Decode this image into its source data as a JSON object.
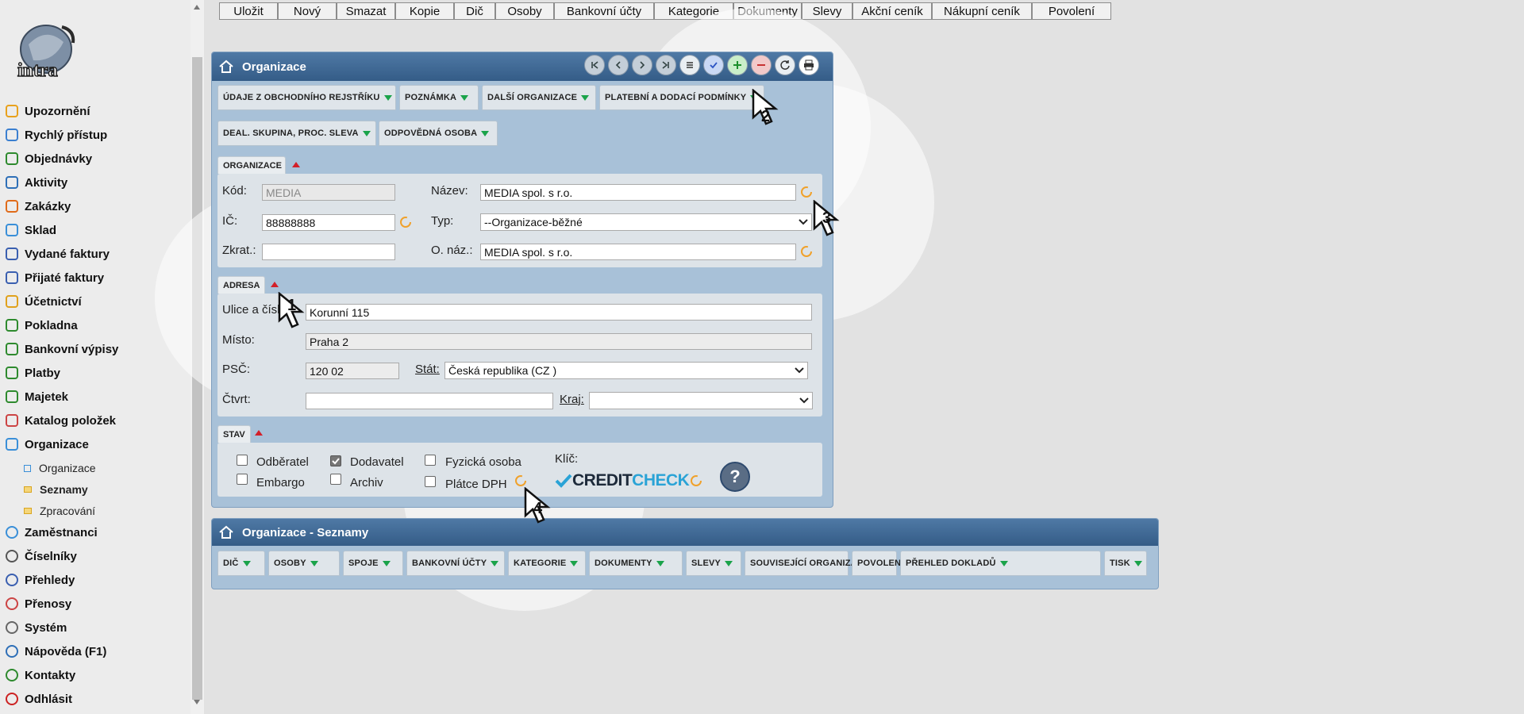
{
  "toolbar": [
    "Uložit",
    "Nový",
    "Smazat",
    "Kopie",
    "Dič",
    "Osoby",
    "Bankovní účty",
    "Kategorie",
    "Dokumenty",
    "Slevy",
    "Akční ceník",
    "Nákupní ceník",
    "Povolení"
  ],
  "sidebar": {
    "logo_text": "intra",
    "items": [
      "Upozornění",
      "Rychlý přístup",
      "Objednávky",
      "Aktivity",
      "Zakázky",
      "Sklad",
      "Vydané faktury",
      "Přijaté faktury",
      "Účetnictví",
      "Pokladna",
      "Bankovní výpisy",
      "Platby",
      "Majetek",
      "Katalog položek",
      "Organizace"
    ],
    "subitems": [
      "Organizace",
      "Seznamy",
      "Zpracování"
    ],
    "items_after": [
      "Zaměstnanci",
      "Číselníky",
      "Přehledy",
      "Přenosy",
      "Systém",
      "Nápověda (F1)",
      "Kontakty",
      "Odhlásit"
    ]
  },
  "org_panel": {
    "title": "Organizace",
    "tabs_row1": [
      "ÚDAJE Z OBCHODNÍHO REJSTŘÍKU",
      "POZNÁMKA",
      "DALŠÍ ORGANIZACE",
      "PLATEBNÍ A DODACÍ PODMÍNKY"
    ],
    "tabs_row2": [
      "DEAL. SKUPINA, PROC. SLEVA",
      "ODPOVĚDNÁ OSOBA"
    ],
    "sec_org": "ORGANIZACE",
    "kod_label": "Kód:",
    "kod_value": "MEDIA",
    "nazev_label": "Název:",
    "nazev_value": "MEDIA spol. s r.o.",
    "ic_label": "IČ:",
    "ic_value": "88888888",
    "typ_label": "Typ:",
    "typ_value": "--Organizace-běžné",
    "zkrat_label": "Zkrat.:",
    "zkrat_value": "",
    "onaz_label": "O. náz.:",
    "onaz_value": "MEDIA spol. s r.o.",
    "sec_adresa": "ADRESA",
    "ulice_label": "Ulice a číslo:",
    "ulice_value": "Korunní 115",
    "misto_label": "Místo:",
    "misto_value": "Praha 2",
    "psc_label": "PSČ:",
    "psc_value": "120 02",
    "stat_label": "Stát:",
    "stat_value": "Česká republika (CZ )",
    "ctvrt_label": "Čtvrt:",
    "ctvrt_value": "",
    "kraj_label": "Kraj:",
    "kraj_value": "",
    "sec_stav": "STAV",
    "odberatel": "Odběratel",
    "dodavatel": "Dodavatel",
    "fyzicka": "Fyzická osoba",
    "embargo": "Embargo",
    "archiv": "Archiv",
    "platce": "Plátce DPH",
    "klic_label": "Klíč:",
    "credit": "CREDIT",
    "check": "CHECK"
  },
  "list_panel": {
    "title": "Organizace - Seznamy",
    "tabs": [
      "DIČ",
      "OSOBY",
      "SPOJE",
      "BANKOVNÍ ÚČTY",
      "KATEGORIE",
      "DOKUMENTY",
      "SLEVY",
      "SOUVISEJÍCÍ ORGANIZACE",
      "POVOLENÍ",
      "PŘEHLED DOKLADŮ",
      "TISK"
    ]
  },
  "callouts": [
    "1",
    "2",
    "3",
    "4"
  ],
  "colors": {
    "header": "#3e6896",
    "panel": "#a8c1d8",
    "tab_arrow": "#1aa34a",
    "collapse_arrow": "#d3202a",
    "creditcheck": "#2aa3d6"
  }
}
